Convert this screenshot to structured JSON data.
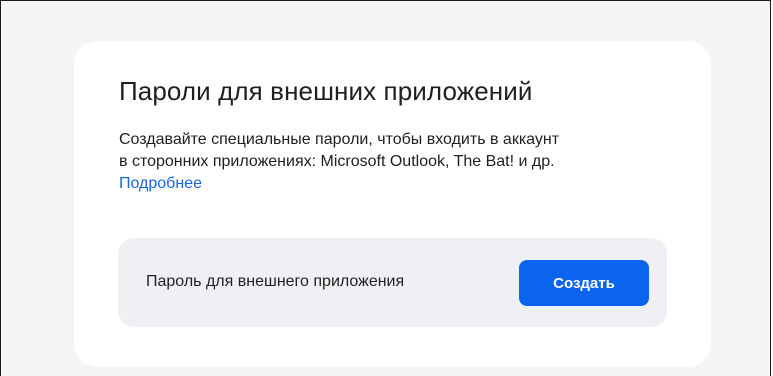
{
  "section": {
    "title": "Пароли для внешних приложений",
    "description_line1": "Создавайте специальные пароли, чтобы входить в аккаунт",
    "description_line2": "в сторонних приложениях: Microsoft Outlook, The Bat! и др.",
    "more_link": "Подробнее"
  },
  "app_password_row": {
    "label": "Пароль для внешнего приложения",
    "create_button": "Создать"
  },
  "colors": {
    "accent": "#0a64f0",
    "link": "#1a66e0",
    "row_background": "#eef0f3",
    "page_background": "#f4f5f7"
  }
}
